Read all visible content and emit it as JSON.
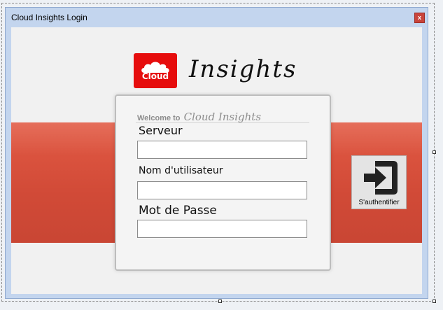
{
  "window": {
    "title": "Cloud Insights Login",
    "close_glyph": "x"
  },
  "logo": {
    "badge_text": "Cloud",
    "brand_text": "Insights",
    "badge_color": "#e60d0d"
  },
  "login": {
    "welcome_prefix": "Welcome to",
    "welcome_brand": "Cloud Insights",
    "fields": [
      {
        "label": "Serveur",
        "value": ""
      },
      {
        "label": "Nom d'utilisateur",
        "value": ""
      },
      {
        "label": "Mot de Passe",
        "value": ""
      }
    ]
  },
  "auth_button": {
    "label": "S'authentifier",
    "icon": "sign-in-icon"
  },
  "colors": {
    "band_red": "#d94f3b",
    "window_frame": "#c3d5ee"
  }
}
